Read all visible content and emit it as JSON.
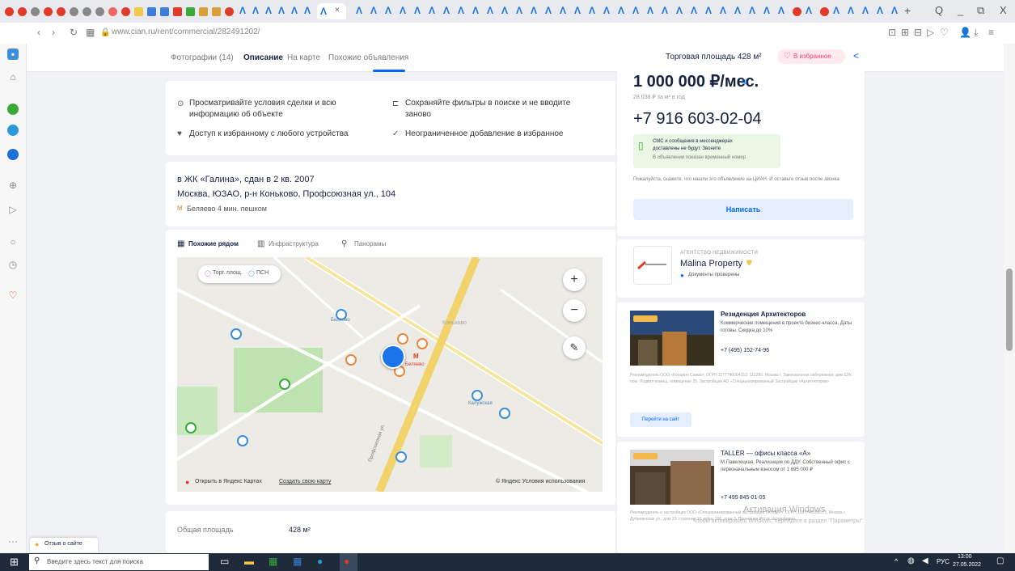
{
  "browser": {
    "url": "www.cian.ru/rent/commercial/282491202/",
    "win_controls": [
      "Q",
      "_",
      "⧉",
      "X"
    ]
  },
  "subnav": {
    "tabs": [
      "Фотографии (14)",
      "Описание",
      "На карте",
      "Похожие объявления"
    ],
    "area_label": "Торговая площадь 428 м²",
    "favorite_label": "В избранное"
  },
  "benefits": [
    "Просматривайте условия сделки и всю информацию об объекте",
    "Сохраняйте фильтры в поиске и не вводите заново",
    "Доступ к избранному с любого устройства",
    "Неограниченное добавление в избранное"
  ],
  "address": {
    "complex": "в ЖК «Галина», сдан в 2 кв. 2007",
    "street": "Москва, ЮЗАО, р-н Коньково, Профсоюзная ул., 104",
    "metro": "Беляево 4 мин. пешком"
  },
  "map_tabs": [
    "Похожие рядом",
    "Инфраструктура",
    "Панорамы"
  ],
  "map": {
    "filter1": "Торг. площ.",
    "filter2": "ПСН",
    "open_in_yandex": "Открыть в Яндекс Картах",
    "create_map": "Создать свою карту",
    "yandex_terms": "© Яндекс Условия использования",
    "labels": [
      "Беляево",
      "Коньково",
      "Беляево",
      "Калужская",
      "Профсоюзная ул."
    ]
  },
  "details": {
    "label": "Общая площадь",
    "value": "428 м²"
  },
  "price": {
    "main": "1 000 000 ₽/мес.",
    "per_m2": "28 038 ₽ за м² в год",
    "phone": "+7 916 603-02-04",
    "sms_note_line1": "СМС и сообщения в мессенджерах",
    "sms_note_line2": "доставлены не будут. Звоните",
    "sms_note_line3": "В объявлении показан временный номер",
    "disclaimer": "Пожалуйста, скажите, что нашли это объявление на ЦИАН. И оставьте отзыв после звонка",
    "write_button": "Написать"
  },
  "agency": {
    "kicker": "АГЕНТСТВО НЕДВИЖИМОСТИ",
    "name": "Malina Property",
    "verified": "Документы проверены"
  },
  "ads": [
    {
      "title": "Резиденция Архитекторов",
      "desc": "Коммерческие помещения в проекте бизнес-класса. Даты готовы. Скидка до 10%",
      "phone": "+7 (495) 152-74-96",
      "legal": "Рекламодатель ООО «Концерн Савва». ОГРН 1177746004153. 115280, Москва г. Завокзальная набережная, дом 12А, пом. Подвал помещ. помещение 25. Застройщик АО «Специализированный Застройщик «Архитекторов»",
      "cta": "Перейти на сайт"
    },
    {
      "title": "TALLER — офисы класса «А»",
      "desc": "М.Павелецкая. Реализация по ДДУ. Собственный офис с первоначальным взносом от 1 695 000 ₽",
      "phone": "+7 495 845-01-05",
      "legal": "Рекламодатель и застройщик ООО «Специализированный застройщик ТАЛЛЕР». ОГРН 1187746596173. Москва г. Дубининская ул., дом 33, строение 15, офис 106, этаж 3. Проектная РН от застройщика"
    }
  ],
  "watermark": "Активация Windows",
  "watermark_sub": "Чтобы активировать Windows, перейдите в раздел \"Параметры\".",
  "feedback": "Отзыв о сайте",
  "taskbar": {
    "search": "Введите здесь текст для поиска",
    "time": "13:00",
    "date": "27.05.2022",
    "lang": "РУС"
  }
}
